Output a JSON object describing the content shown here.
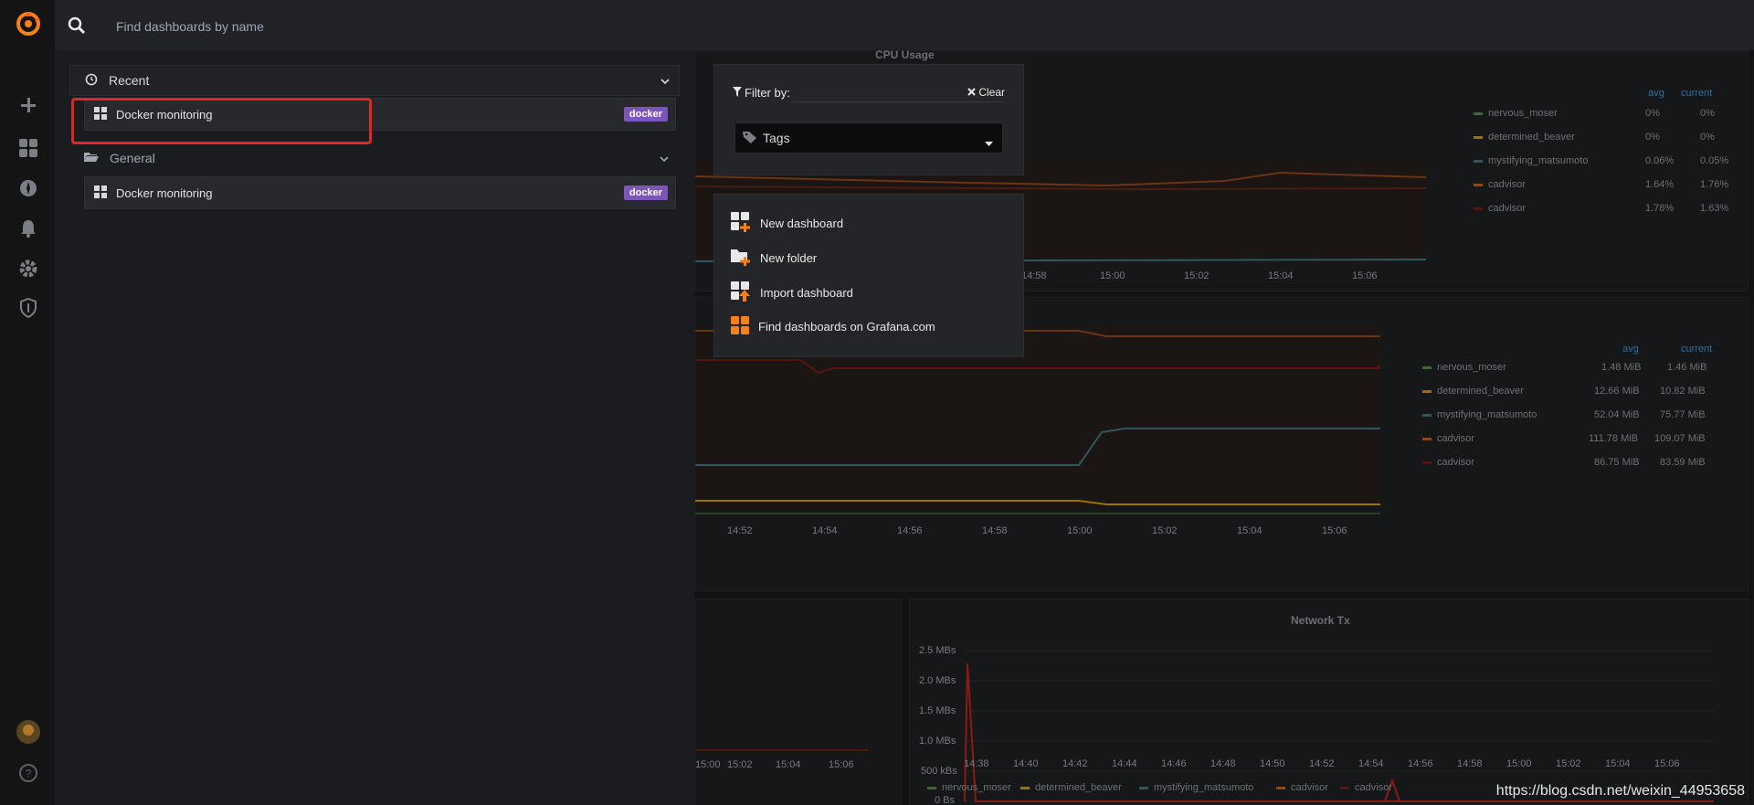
{
  "search": {
    "placeholder": "Find dashboards by name"
  },
  "sections": {
    "recent": {
      "title": "Recent",
      "items": [
        {
          "name": "Docker monitoring",
          "tag": "docker"
        }
      ]
    },
    "general": {
      "title": "General",
      "items": [
        {
          "name": "Docker monitoring",
          "tag": "docker"
        }
      ]
    }
  },
  "filter": {
    "label": "Filter by:",
    "clear": "Clear",
    "tags_label": "Tags"
  },
  "actions": {
    "new_dashboard": "New dashboard",
    "new_folder": "New folder",
    "import_dashboard": "Import dashboard",
    "find_grafana": "Find dashboards on Grafana.com"
  },
  "colors": {
    "accent": "#f6811a",
    "tag": "#7b55b9",
    "highlight": "#e32624"
  },
  "background_panels": {
    "cpu": {
      "title": "CPU Usage",
      "legend_headers": [
        "avg",
        "current"
      ],
      "x_ticks": [
        "14:58",
        "15:00",
        "15:02",
        "15:04",
        "15:06"
      ],
      "legend": [
        {
          "name": "nervous_moser",
          "avg": "0%",
          "current": "0%",
          "color": "#3f6833"
        },
        {
          "name": "determined_beaver",
          "avg": "0%",
          "current": "0%",
          "color": "#967302"
        },
        {
          "name": "mystifying_matsumoto",
          "avg": "0.06%",
          "current": "0.05%",
          "color": "#2f575e"
        },
        {
          "name": "cadvisor",
          "avg": "1.64%",
          "current": "1.76%",
          "color": "#99440a"
        },
        {
          "name": "cadvisor",
          "avg": "1.78%",
          "current": "1.63%",
          "color": "#58140c"
        }
      ]
    },
    "memory": {
      "legend_headers": [
        "avg",
        "current"
      ],
      "x_ticks": [
        "14:52",
        "14:54",
        "14:56",
        "14:58",
        "15:00",
        "15:02",
        "15:04",
        "15:06"
      ],
      "legend": [
        {
          "name": "nervous_moser",
          "avg": "1.48 MiB",
          "current": "1.46 MiB",
          "color": "#3f6833"
        },
        {
          "name": "determined_beaver",
          "avg": "12.66 MiB",
          "current": "10.82 MiB",
          "color": "#967302"
        },
        {
          "name": "mystifying_matsumoto",
          "avg": "52.04 MiB",
          "current": "75.77 MiB",
          "color": "#2f575e"
        },
        {
          "name": "cadvisor",
          "avg": "111.78 MiB",
          "current": "109.07 MiB",
          "color": "#99440a"
        },
        {
          "name": "cadvisor",
          "avg": "86.75 MiB",
          "current": "83.59 MiB",
          "color": "#58140c"
        }
      ]
    },
    "network_rx_partial": {
      "x_ticks": [
        "15:00",
        "15:02",
        "15:04",
        "15:06"
      ]
    },
    "network_tx": {
      "title": "Network Tx",
      "y_ticks": [
        "2.5 MBs",
        "2.0 MBs",
        "1.5 MBs",
        "1.0 MBs",
        "500 kBs",
        "0 Bs"
      ],
      "x_ticks": [
        "14:38",
        "14:40",
        "14:42",
        "14:44",
        "14:46",
        "14:48",
        "14:50",
        "14:52",
        "14:54",
        "14:56",
        "14:58",
        "15:00",
        "15:02",
        "15:04",
        "15:06"
      ],
      "legend": [
        "nervous_moser",
        "determined_beaver",
        "mystifying_matsumoto",
        "cadvisor",
        "cadvisor"
      ]
    }
  },
  "watermark": "https://blog.csdn.net/weixin_44953658"
}
